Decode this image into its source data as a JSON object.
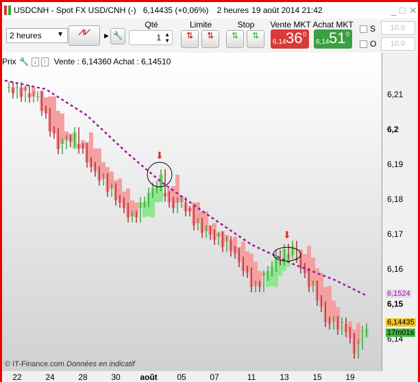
{
  "title": {
    "symbol": "USDCNH - Spot FX USD/CNH (-)",
    "price": "6,14435 (+0,06%)",
    "period": "2 heures",
    "date": "19 août 2014 21:42"
  },
  "toolbar": {
    "timeframe": "2 heures",
    "qty_label": "Qté",
    "qty_value": "1",
    "limit_label": "Limite",
    "stop_label": "Stop",
    "sell": {
      "label": "Vente MKT",
      "small": "6,14",
      "big": "36",
      "sup": "0",
      "color": "#d93a3a"
    },
    "buy": {
      "label": "Achat MKT",
      "small": "6,14",
      "big": "51",
      "sup": "0",
      "color": "#3aa040"
    },
    "s_label": "S",
    "o_label": "O",
    "s_value": "10.0",
    "o_value": "10.0"
  },
  "info": {
    "prix": "Prix",
    "quote": "Vente : 6,14360 Achat : 6,14510"
  },
  "axis": {
    "y_ticks": [
      {
        "v": 6.21,
        "t": "6,21",
        "bold": false
      },
      {
        "v": 6.2,
        "t": "6,2",
        "bold": true
      },
      {
        "v": 6.19,
        "t": "6,19",
        "bold": false
      },
      {
        "v": 6.18,
        "t": "6,18",
        "bold": false
      },
      {
        "v": 6.17,
        "t": "6,17",
        "bold": false
      },
      {
        "v": 6.16,
        "t": "6,16",
        "bold": false
      },
      {
        "v": 6.15,
        "t": "6,15",
        "bold": true
      },
      {
        "v": 6.14,
        "t": "6,14",
        "bold": false
      }
    ],
    "x_ticks": [
      {
        "i": 3,
        "t": "22"
      },
      {
        "i": 11,
        "t": "24"
      },
      {
        "i": 19,
        "t": "28"
      },
      {
        "i": 27,
        "t": "30"
      },
      {
        "i": 35,
        "t": "août"
      },
      {
        "i": 43,
        "t": "05"
      },
      {
        "i": 51,
        "t": "07"
      },
      {
        "i": 60,
        "t": "11"
      },
      {
        "i": 68,
        "t": "13"
      },
      {
        "i": 76,
        "t": "15"
      },
      {
        "i": 84,
        "t": "19"
      }
    ],
    "ma_tag": "6,1524",
    "price_tag": "6,14435",
    "timer_tag": "17m01s"
  },
  "footer": {
    "copyright": "© IT-Finance.com",
    "note": "Données en indicatif"
  },
  "chart_data": {
    "type": "candlestick",
    "ylim": [
      6.1325,
      6.2175
    ],
    "anchors": [
      [
        0,
        6.212
      ],
      [
        8,
        6.209
      ],
      [
        13,
        6.195
      ],
      [
        17,
        6.198
      ],
      [
        21,
        6.189
      ],
      [
        26,
        6.182
      ],
      [
        31,
        6.174
      ],
      [
        34,
        6.18
      ],
      [
        38,
        6.186
      ],
      [
        40,
        6.178
      ],
      [
        43,
        6.179
      ],
      [
        47,
        6.172
      ],
      [
        51,
        6.169
      ],
      [
        55,
        6.166
      ],
      [
        57,
        6.162
      ],
      [
        61,
        6.154
      ],
      [
        66,
        6.163
      ],
      [
        70,
        6.166
      ],
      [
        73,
        6.158
      ],
      [
        76,
        6.152
      ],
      [
        78,
        6.145
      ],
      [
        83,
        6.143
      ],
      [
        85,
        6.136
      ],
      [
        88,
        6.144
      ]
    ],
    "ma": [
      [
        0,
        6.214
      ],
      [
        10,
        6.2115
      ],
      [
        20,
        6.204
      ],
      [
        30,
        6.193
      ],
      [
        38,
        6.185
      ],
      [
        50,
        6.175
      ],
      [
        60,
        6.167
      ],
      [
        70,
        6.1615
      ],
      [
        80,
        6.157
      ],
      [
        88,
        6.1524
      ]
    ],
    "arrows": [
      38,
      69
    ]
  }
}
